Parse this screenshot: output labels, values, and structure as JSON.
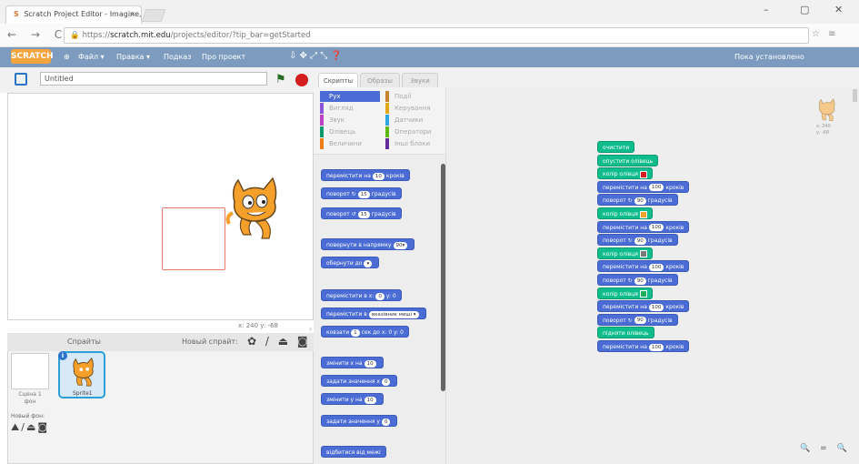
{
  "browser": {
    "tab_title": "Scratch Project Editor - Imagine, Program, Share",
    "tab_close": "×",
    "favicon": "S",
    "url_prefix": "https://",
    "url_host": "scratch.mit.edu",
    "url_path": "/projects/editor/?tip_bar=getStarted",
    "window_controls": [
      "–",
      "▢",
      "✕"
    ],
    "nav": "← → C",
    "ext_icons": "☆ ≡"
  },
  "scratch_menu": {
    "logo": "SCRATCH",
    "items": [
      "Файл ▾",
      "Правка ▾",
      "Подказ",
      "Про проект"
    ],
    "tools": "⇩ ✥ ⤢ ⤡ ❓",
    "right_link": "Пока установлено"
  },
  "stage": {
    "project_name": "Untitled",
    "coords": "x: 240  y: -68"
  },
  "sprites_pane": {
    "title": "Спрайты",
    "new_sprite_label": "Новый спрайт:",
    "new_sprite_icons": "✿ / ⏏ ◙",
    "stage_label": "Сцена 1 фон",
    "new_backdrop_label": "Новый фон:",
    "new_backdrop_icons": "⛰/⏏◙",
    "sprite_name": "Sprite1"
  },
  "palette_tabs": [
    "Скрипты",
    "Образы",
    "Звуки"
  ],
  "categories": [
    {
      "label": "Рух",
      "color": "#4a6cd4",
      "selected": true
    },
    {
      "label": "Події",
      "color": "#c88330"
    },
    {
      "label": "Вигляд",
      "color": "#8a55d7"
    },
    {
      "label": "Керування",
      "color": "#e1a91a"
    },
    {
      "label": "Звук",
      "color": "#bb42c3"
    },
    {
      "label": "Датчики",
      "color": "#2ca5e2"
    },
    {
      "label": "Олівець",
      "color": "#0e9a6c"
    },
    {
      "label": "Оператори",
      "color": "#5cb712"
    },
    {
      "label": "Величини",
      "color": "#ee7d16"
    },
    {
      "label": "Інші блоки",
      "color": "#632d99"
    }
  ],
  "palette_blocks": [
    {
      "text": "перемістити на",
      "num": "10",
      "tail": "кроків"
    },
    {
      "text": "поворот ↻",
      "num": "15",
      "tail": "градусів"
    },
    {
      "text": "поворот ↺",
      "num": "15",
      "tail": "градусів"
    },
    {
      "text": "повернути в напрямку",
      "num": "90▾",
      "tail": ""
    },
    {
      "text": "обернути до",
      "num": "▾",
      "tail": ""
    },
    {
      "text": "перемістити в x:",
      "num": "0",
      "tail": "y: 0"
    },
    {
      "text": "перемістити в",
      "num": "вказівник миші ▾",
      "tail": ""
    },
    {
      "text": "ковзати",
      "num": "1",
      "tail": "сек до x: 0 y: 0"
    },
    {
      "text": "змінити x на",
      "num": "10",
      "tail": ""
    },
    {
      "text": "задати значення x",
      "num": "0",
      "tail": ""
    },
    {
      "text": "змінити y на",
      "num": "10",
      "tail": ""
    },
    {
      "text": "задати значення y",
      "num": "0",
      "tail": ""
    },
    {
      "text": "відбитися від межі",
      "num": "",
      "tail": ""
    }
  ],
  "script": [
    {
      "type": "pen",
      "text": "очистити"
    },
    {
      "type": "pen",
      "text": "опустити олівець"
    },
    {
      "type": "pen",
      "text": "колір олівця",
      "swatch": "#d21e1e"
    },
    {
      "type": "motion",
      "text": "перемістити на",
      "num": "100",
      "tail": "кроків"
    },
    {
      "type": "motion",
      "text": "поворот ↻",
      "num": "90",
      "tail": "градусів"
    },
    {
      "type": "pen",
      "text": "колір олівця",
      "swatch": "#f0a32a"
    },
    {
      "type": "motion",
      "text": "перемістити на",
      "num": "100",
      "tail": "кроків"
    },
    {
      "type": "motion",
      "text": "поворот ↻",
      "num": "90",
      "tail": "градусів"
    },
    {
      "type": "pen",
      "text": "колір олівця",
      "swatch": "#7a7a7a"
    },
    {
      "type": "motion",
      "text": "перемістити на",
      "num": "100",
      "tail": "кроків"
    },
    {
      "type": "motion",
      "text": "поворот ↻",
      "num": "90",
      "tail": "градусів"
    },
    {
      "type": "pen",
      "text": "колір олівця",
      "swatch": "#1fae5e"
    },
    {
      "type": "motion",
      "text": "перемістити на",
      "num": "100",
      "tail": "кроків"
    },
    {
      "type": "motion",
      "text": "поворот ↻",
      "num": "90",
      "tail": "градусів"
    },
    {
      "type": "pen",
      "text": "підняти олівець"
    },
    {
      "type": "motion",
      "text": "перемістити на",
      "num": "100",
      "tail": "кроків"
    }
  ],
  "sprite_corner_xy": "x: 240\ny: -68",
  "zoom_icons": "🔍 = 🔍"
}
